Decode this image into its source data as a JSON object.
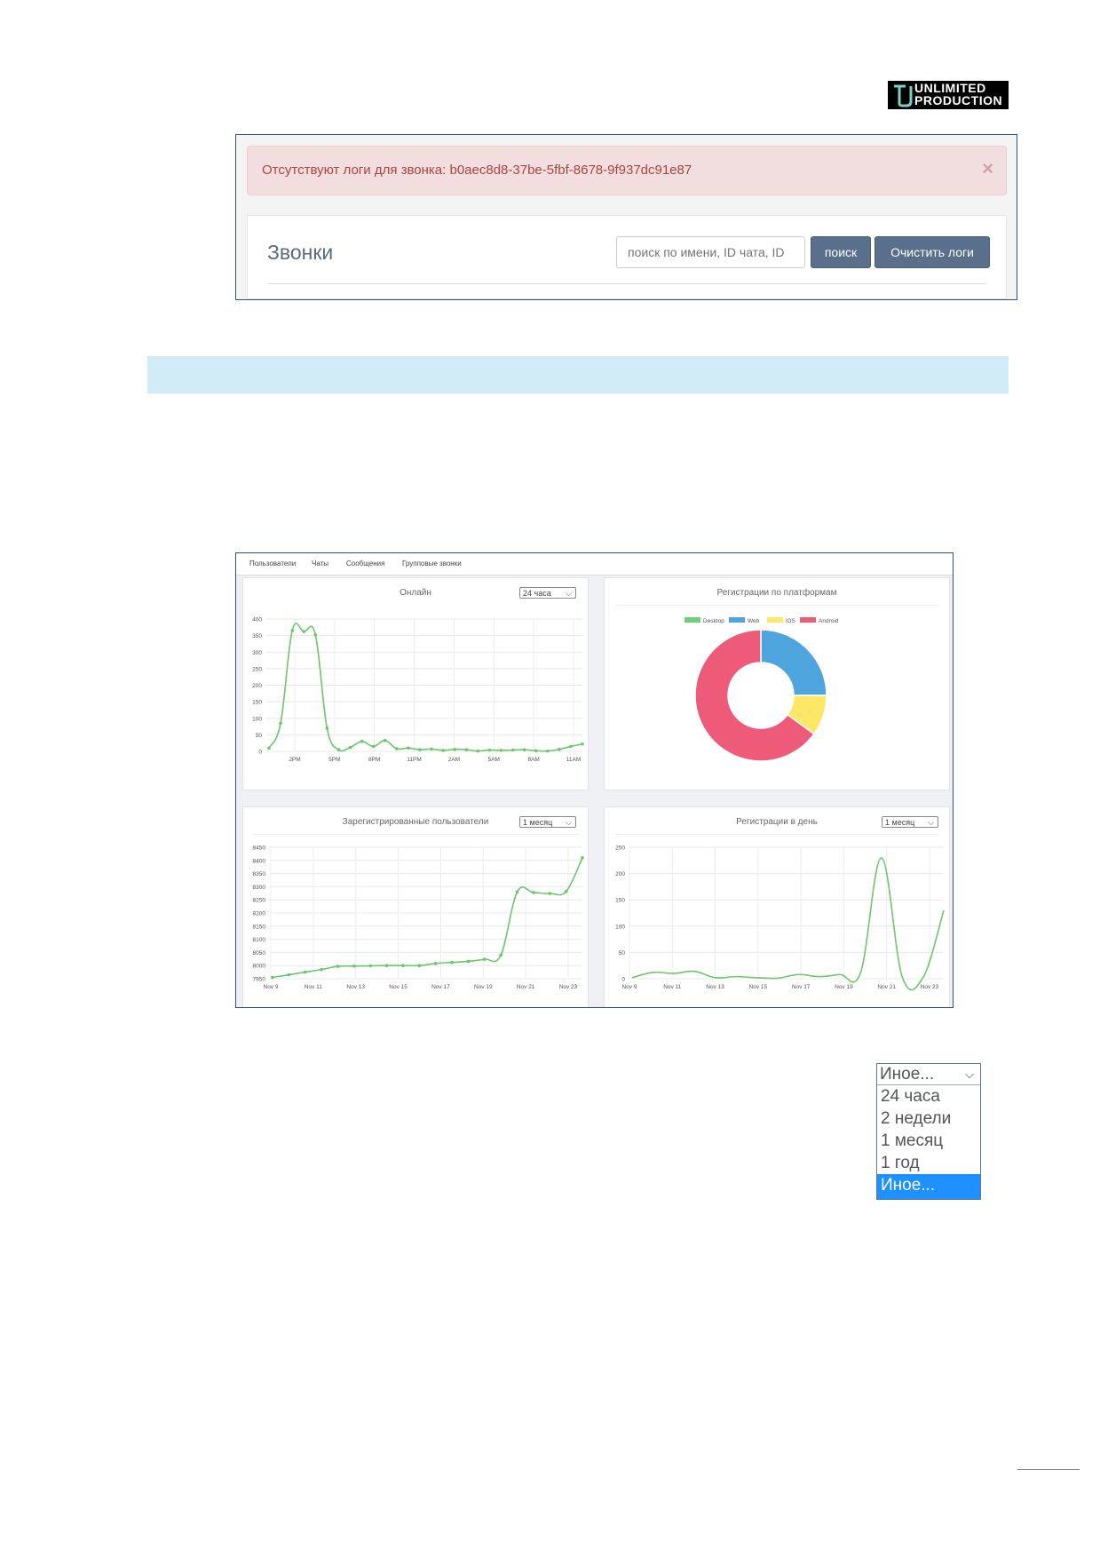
{
  "logo": {
    "line1": "UNLIMITED",
    "line2": "PRODUCTION"
  },
  "calls": {
    "alert_text": "Отсутствуют логи для звонка: b0aec8d8-37be-5fbf-8678-9f937dc91e87",
    "alert_close": "×",
    "title": "Звонки",
    "search_placeholder": "поиск по имени, ID чата, ID",
    "search_button": "поиск",
    "clear_button": "Очистить логи"
  },
  "dashboard": {
    "nav": [
      "Пользователи",
      "Чаты",
      "Сообщения",
      "Групповые звонки"
    ],
    "panels": {
      "online": {
        "title": "Онлайн",
        "select": "24 часа"
      },
      "platforms": {
        "title": "Регистрации по платформам"
      },
      "registered": {
        "title": "Зарегистрированные пользователи",
        "select": "1 месяц"
      },
      "daily": {
        "title": "Регистрации в день",
        "select": "1 месяц"
      }
    }
  },
  "dropdown": {
    "selected": "Иное...",
    "options": [
      "24 часа",
      "2 недели",
      "1 месяц",
      "1 год",
      "Иное..."
    ],
    "highlighted_index": 4
  },
  "colors": {
    "line": "#6cc66c",
    "desktop": "#6ccf7a",
    "web": "#4ea4dc",
    "ios": "#fde766",
    "android": "#ee5b7a",
    "alert_text": "#a94442",
    "button": "#5a6f8c",
    "highlight": "#1e90ff"
  },
  "chart_data": [
    {
      "type": "line",
      "title": "Онлайн",
      "x_ticks": [
        "2PM",
        "5PM",
        "8PM",
        "11PM",
        "2AM",
        "5AM",
        "8AM",
        "11AM"
      ],
      "y_ticks": [
        0,
        50,
        100,
        150,
        200,
        250,
        300,
        350,
        400
      ],
      "ylim": [
        0,
        400
      ],
      "values": [
        10,
        85,
        365,
        362,
        352,
        70,
        5,
        12,
        30,
        15,
        33,
        8,
        10,
        5,
        7,
        3,
        6,
        5,
        1,
        4,
        3,
        4,
        5,
        2,
        1,
        6,
        15,
        22
      ]
    },
    {
      "type": "pie",
      "title": "Регистрации по платформам",
      "legend": [
        "Desktop",
        "Web",
        "iOS",
        "Android"
      ],
      "values": [
        0,
        25,
        10,
        65
      ]
    },
    {
      "type": "line",
      "title": "Зарегистрированные пользователи",
      "x_ticks": [
        "Nov 9",
        "Nov 11",
        "Nov 13",
        "Nov 15",
        "Nov 17",
        "Nov 19",
        "Nov 21",
        "Nov 23"
      ],
      "y_ticks": [
        7950,
        8000,
        8050,
        8100,
        8150,
        8200,
        8250,
        8300,
        8350,
        8400,
        8450
      ],
      "ylim": [
        7950,
        8450
      ],
      "values": [
        7955,
        7965,
        7975,
        7985,
        7997,
        7998,
        7999,
        8000,
        8000,
        8000,
        8008,
        8012,
        8016,
        8024,
        8040,
        8280,
        8278,
        8274,
        8282,
        8410
      ]
    },
    {
      "type": "line",
      "title": "Регистрации в день",
      "x_ticks": [
        "Nov 9",
        "Nov 11",
        "Nov 13",
        "Nov 15",
        "Nov 17",
        "Nov 19",
        "Nov 21",
        "Nov 23"
      ],
      "y_ticks": [
        0,
        50,
        100,
        150,
        200,
        250
      ],
      "ylim": [
        0,
        250
      ],
      "values": [
        2,
        12,
        10,
        14,
        2,
        4,
        2,
        1,
        8,
        4,
        8,
        12,
        230,
        4,
        2,
        130
      ]
    }
  ]
}
